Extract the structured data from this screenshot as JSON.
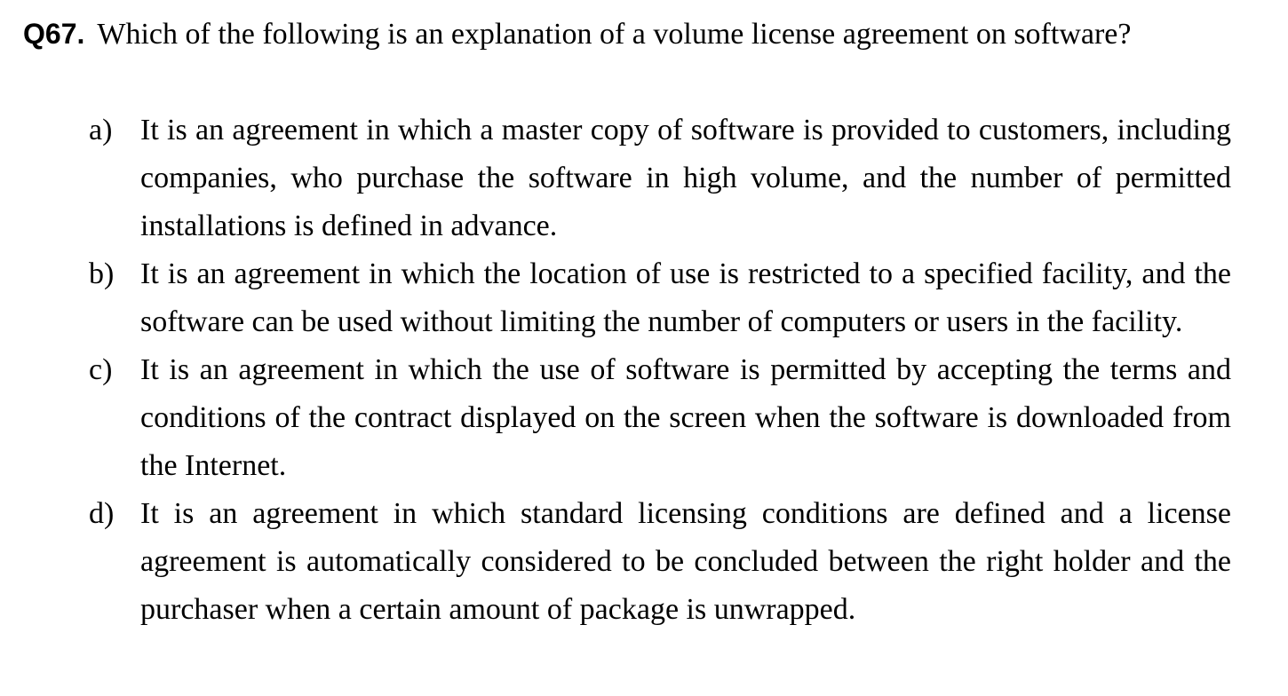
{
  "question": {
    "number": "Q67.",
    "text": "Which of the following is an explanation of a volume license agreement on software?"
  },
  "options": [
    {
      "letter": "a)",
      "text": "It is an agreement in which a master copy of software is provided to customers, including companies, who purchase the software in high volume, and the number of permitted installations is defined in advance."
    },
    {
      "letter": "b)",
      "text": "It is an agreement in which the location of use is restricted to a specified facility, and the software can be used without limiting the number of computers or users in the facility."
    },
    {
      "letter": "c)",
      "text": "It is an agreement in which the use of software is permitted by accepting the terms and conditions of the contract displayed on the screen when the software is downloaded from the Internet."
    },
    {
      "letter": "d)",
      "text": "It is an agreement in which standard licensing conditions are defined and a license agreement is automatically considered to be concluded between the right holder and the purchaser when a certain amount of package is unwrapped."
    }
  ]
}
